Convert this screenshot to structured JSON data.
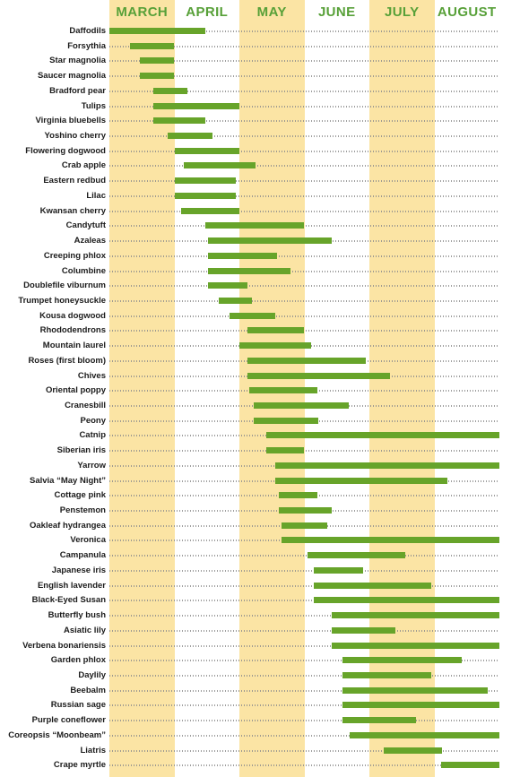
{
  "colors": {
    "band": "#fbe4a4",
    "bar": "#67a42a",
    "month_text": "#57a038",
    "label_text": "#1b1b1b",
    "background": "#ffffff"
  },
  "header": {
    "months": [
      "MARCH",
      "APRIL",
      "MAY",
      "JUNE",
      "JULY",
      "AUGUST"
    ]
  },
  "chart_data": {
    "type": "bar",
    "title": "",
    "subtitle": "",
    "xlabel": "",
    "ylabel": "",
    "orientation": "horizontal",
    "style": "gantt-bloom-period",
    "axis_months": [
      "MARCH",
      "APRIL",
      "MAY",
      "JUNE",
      "JULY",
      "AUGUST"
    ],
    "x_axis_start": "March 1",
    "x_axis_end": "August 31",
    "shaded_months": [
      "MARCH",
      "MAY",
      "JULY"
    ],
    "grid": "dotted-row-guides",
    "legend": "none",
    "units": "month fraction (0 = Mar 1, 6 = Aug 31)",
    "categories": [
      "Daffodils",
      "Forsythia",
      "Star magnolia",
      "Saucer magnolia",
      "Bradford pear",
      "Tulips",
      "Virginia bluebells",
      "Yoshino cherry",
      "Flowering dogwood",
      "Crab apple",
      "Eastern redbud",
      "Lilac",
      "Kwansan cherry",
      "Candytuft",
      "Azaleas",
      "Creeping phlox",
      "Columbine",
      "Doublefile viburnum",
      "Trumpet honeysuckle",
      "Kousa dogwood",
      "Rhododendrons",
      "Mountain laurel",
      "Roses (first bloom)",
      "Chives",
      "Oriental poppy",
      "Cranesbill",
      "Peony",
      "Catnip",
      "Siberian iris",
      "Yarrow",
      "Salvia “May Night”",
      "Cottage pink",
      "Penstemon",
      "Oakleaf hydrangea",
      "Veronica",
      "Campanula",
      "Japanese iris",
      "English lavender",
      "Black-Eyed Susan",
      "Butterfly bush",
      "Asiatic lily",
      "Verbena bonariensis",
      "Garden phlox",
      "Daylily",
      "Beebalm",
      "Russian sage",
      "Purple coneflower",
      "Coreopsis “Moonbeam”",
      "Liatris",
      "Crape myrtle"
    ],
    "bars": [
      {
        "name": "Daffodils",
        "start": 0.0,
        "end": 1.47
      },
      {
        "name": "Forsythia",
        "start": 0.32,
        "end": 1.0
      },
      {
        "name": "Star magnolia",
        "start": 0.47,
        "end": 1.0
      },
      {
        "name": "Saucer magnolia",
        "start": 0.47,
        "end": 1.0
      },
      {
        "name": "Bradford pear",
        "start": 0.68,
        "end": 1.2
      },
      {
        "name": "Tulips",
        "start": 0.68,
        "end": 2.0
      },
      {
        "name": "Virginia bluebells",
        "start": 0.68,
        "end": 1.47
      },
      {
        "name": "Yoshino cherry",
        "start": 0.9,
        "end": 1.58
      },
      {
        "name": "Flowering dogwood",
        "start": 1.0,
        "end": 2.0
      },
      {
        "name": "Crab apple",
        "start": 1.15,
        "end": 2.25
      },
      {
        "name": "Eastern redbud",
        "start": 1.0,
        "end": 1.95
      },
      {
        "name": "Lilac",
        "start": 1.0,
        "end": 1.95
      },
      {
        "name": "Kwansan cherry",
        "start": 1.1,
        "end": 2.0
      },
      {
        "name": "Candytuft",
        "start": 1.47,
        "end": 3.0
      },
      {
        "name": "Azaleas",
        "start": 1.52,
        "end": 3.42
      },
      {
        "name": "Creeping phlox",
        "start": 1.52,
        "end": 2.58
      },
      {
        "name": "Columbine",
        "start": 1.52,
        "end": 2.79
      },
      {
        "name": "Doublefile viburnum",
        "start": 1.52,
        "end": 2.12
      },
      {
        "name": "Trumpet honeysuckle",
        "start": 1.68,
        "end": 2.2
      },
      {
        "name": "Kousa dogwood",
        "start": 1.85,
        "end": 2.55
      },
      {
        "name": "Rhododendrons",
        "start": 2.12,
        "end": 3.0
      },
      {
        "name": "Mountain laurel",
        "start": 2.0,
        "end": 3.1
      },
      {
        "name": "Roses (first bloom)",
        "start": 2.12,
        "end": 3.95
      },
      {
        "name": "Chives",
        "start": 2.12,
        "end": 4.32
      },
      {
        "name": "Oriental poppy",
        "start": 2.15,
        "end": 3.2
      },
      {
        "name": "Cranesbill",
        "start": 2.22,
        "end": 3.68
      },
      {
        "name": "Peony",
        "start": 2.22,
        "end": 3.22
      },
      {
        "name": "Catnip",
        "start": 2.42,
        "end": 6.0
      },
      {
        "name": "Siberian iris",
        "start": 2.42,
        "end": 3.0
      },
      {
        "name": "Yarrow",
        "start": 2.55,
        "end": 6.0
      },
      {
        "name": "Salvia “May Night”",
        "start": 2.55,
        "end": 5.2
      },
      {
        "name": "Cottage pink",
        "start": 2.6,
        "end": 3.2
      },
      {
        "name": "Penstemon",
        "start": 2.6,
        "end": 3.42
      },
      {
        "name": "Oakleaf hydrangea",
        "start": 2.65,
        "end": 3.35
      },
      {
        "name": "Veronica",
        "start": 2.65,
        "end": 6.0
      },
      {
        "name": "Campanula",
        "start": 3.05,
        "end": 4.55
      },
      {
        "name": "Japanese iris",
        "start": 3.15,
        "end": 3.9
      },
      {
        "name": "English lavender",
        "start": 3.15,
        "end": 4.95
      },
      {
        "name": "Black-Eyed Susan",
        "start": 3.15,
        "end": 6.0
      },
      {
        "name": "Butterfly bush",
        "start": 3.42,
        "end": 6.0
      },
      {
        "name": "Asiatic lily",
        "start": 3.42,
        "end": 4.4
      },
      {
        "name": "Verbena bonariensis",
        "start": 3.42,
        "end": 6.0
      },
      {
        "name": "Garden phlox",
        "start": 3.58,
        "end": 5.42
      },
      {
        "name": "Daylily",
        "start": 3.58,
        "end": 4.95
      },
      {
        "name": "Beebalm",
        "start": 3.58,
        "end": 5.82
      },
      {
        "name": "Russian sage",
        "start": 3.58,
        "end": 6.0
      },
      {
        "name": "Purple coneflower",
        "start": 3.58,
        "end": 4.72
      },
      {
        "name": "Coreopsis “Moonbeam”",
        "start": 3.7,
        "end": 6.0
      },
      {
        "name": "Liatris",
        "start": 4.22,
        "end": 5.12
      },
      {
        "name": "Crape myrtle",
        "start": 5.1,
        "end": 6.0
      }
    ]
  }
}
